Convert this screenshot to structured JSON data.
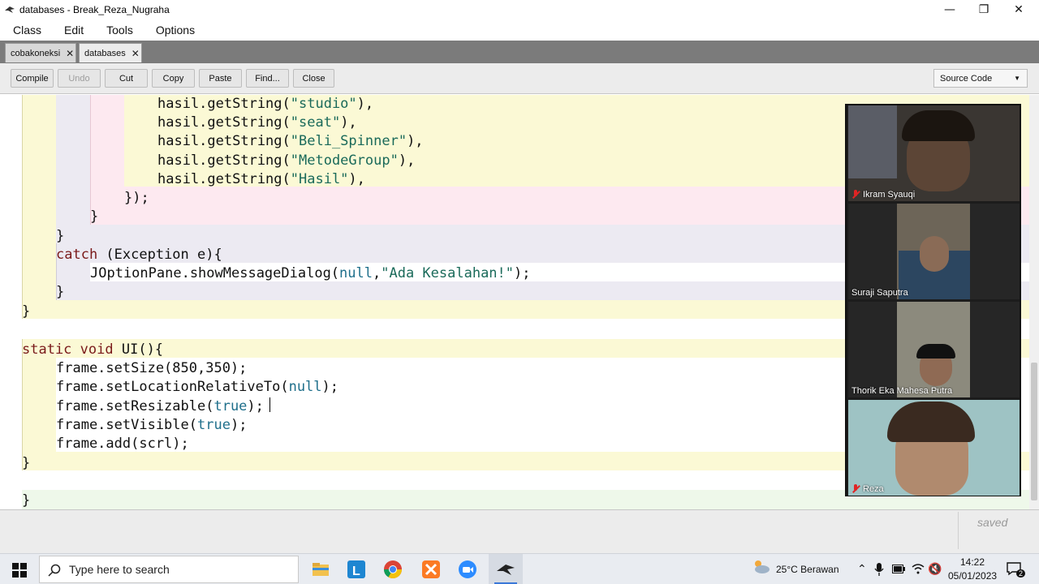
{
  "window": {
    "title": "databases - Break_Reza_Nugraha"
  },
  "menu": [
    "Class",
    "Edit",
    "Tools",
    "Options"
  ],
  "tabs": [
    {
      "label": "cobakoneksi",
      "active": false
    },
    {
      "label": "databases",
      "active": true
    }
  ],
  "toolbar": {
    "compile": "Compile",
    "undo": "Undo",
    "cut": "Cut",
    "copy": "Copy",
    "paste": "Paste",
    "find": "Find...",
    "close": "Close",
    "source_mode": "Source Code"
  },
  "code": [
    [
      [
        "hasil.getString(",
        ""
      ],
      [
        "\"studio\"",
        "str"
      ],
      [
        "),",
        ""
      ]
    ],
    [
      [
        "hasil.getString(",
        ""
      ],
      [
        "\"seat\"",
        "str"
      ],
      [
        "),",
        ""
      ]
    ],
    [
      [
        "hasil.getString(",
        ""
      ],
      [
        "\"Beli_Spinner\"",
        "str"
      ],
      [
        "),",
        ""
      ]
    ],
    [
      [
        "hasil.getString(",
        ""
      ],
      [
        "\"MetodeGroup\"",
        "str"
      ],
      [
        "),",
        ""
      ]
    ],
    [
      [
        "hasil.getString(",
        ""
      ],
      [
        "\"Hasil\"",
        "str"
      ],
      [
        "),",
        ""
      ]
    ],
    [
      [
        "});",
        ""
      ]
    ],
    [
      [
        "}",
        ""
      ]
    ],
    [
      [
        "}",
        ""
      ]
    ],
    [
      [
        "catch",
        "kw"
      ],
      [
        " (Exception e){",
        ""
      ]
    ],
    [
      [
        "JOptionPane.showMessageDialog(",
        ""
      ],
      [
        "null",
        "lit"
      ],
      [
        ",",
        ""
      ],
      [
        "\"Ada Kesalahan!\"",
        "str"
      ],
      [
        ");",
        ""
      ]
    ],
    [
      [
        "}",
        ""
      ]
    ],
    [
      [
        "}",
        ""
      ]
    ],
    [
      [
        "",
        ""
      ]
    ],
    [
      [
        "static",
        "kw"
      ],
      [
        " ",
        ""
      ],
      [
        "void",
        "kw"
      ],
      [
        " UI(){",
        ""
      ]
    ],
    [
      [
        "frame.setSize(850,350);",
        ""
      ]
    ],
    [
      [
        "frame.setLocationRelativeTo(",
        ""
      ],
      [
        "null",
        "lit"
      ],
      [
        ");",
        ""
      ]
    ],
    [
      [
        "frame.setResizable(",
        ""
      ],
      [
        "true",
        "lit"
      ],
      [
        ");",
        ""
      ]
    ],
    [
      [
        "frame.setVisible(",
        ""
      ],
      [
        "true",
        "lit"
      ],
      [
        ");",
        ""
      ]
    ],
    [
      [
        "frame.add(scrl);",
        ""
      ]
    ],
    [
      [
        "}",
        ""
      ]
    ],
    [
      [
        "",
        ""
      ]
    ],
    [
      [
        "}",
        ""
      ]
    ]
  ],
  "status": {
    "saved": "saved"
  },
  "participants": [
    {
      "name": "Ikram Syauqi",
      "muted": true
    },
    {
      "name": "Suraji Saputra",
      "muted": false
    },
    {
      "name": "Thorik Eka Mahesa Putra",
      "muted": false
    },
    {
      "name": "Reza",
      "muted": true
    }
  ],
  "taskbar": {
    "search_placeholder": "Type here to search",
    "weather": "25°C  Berawan",
    "time": "14:22",
    "date": "05/01/2023",
    "notification_count": "2"
  }
}
